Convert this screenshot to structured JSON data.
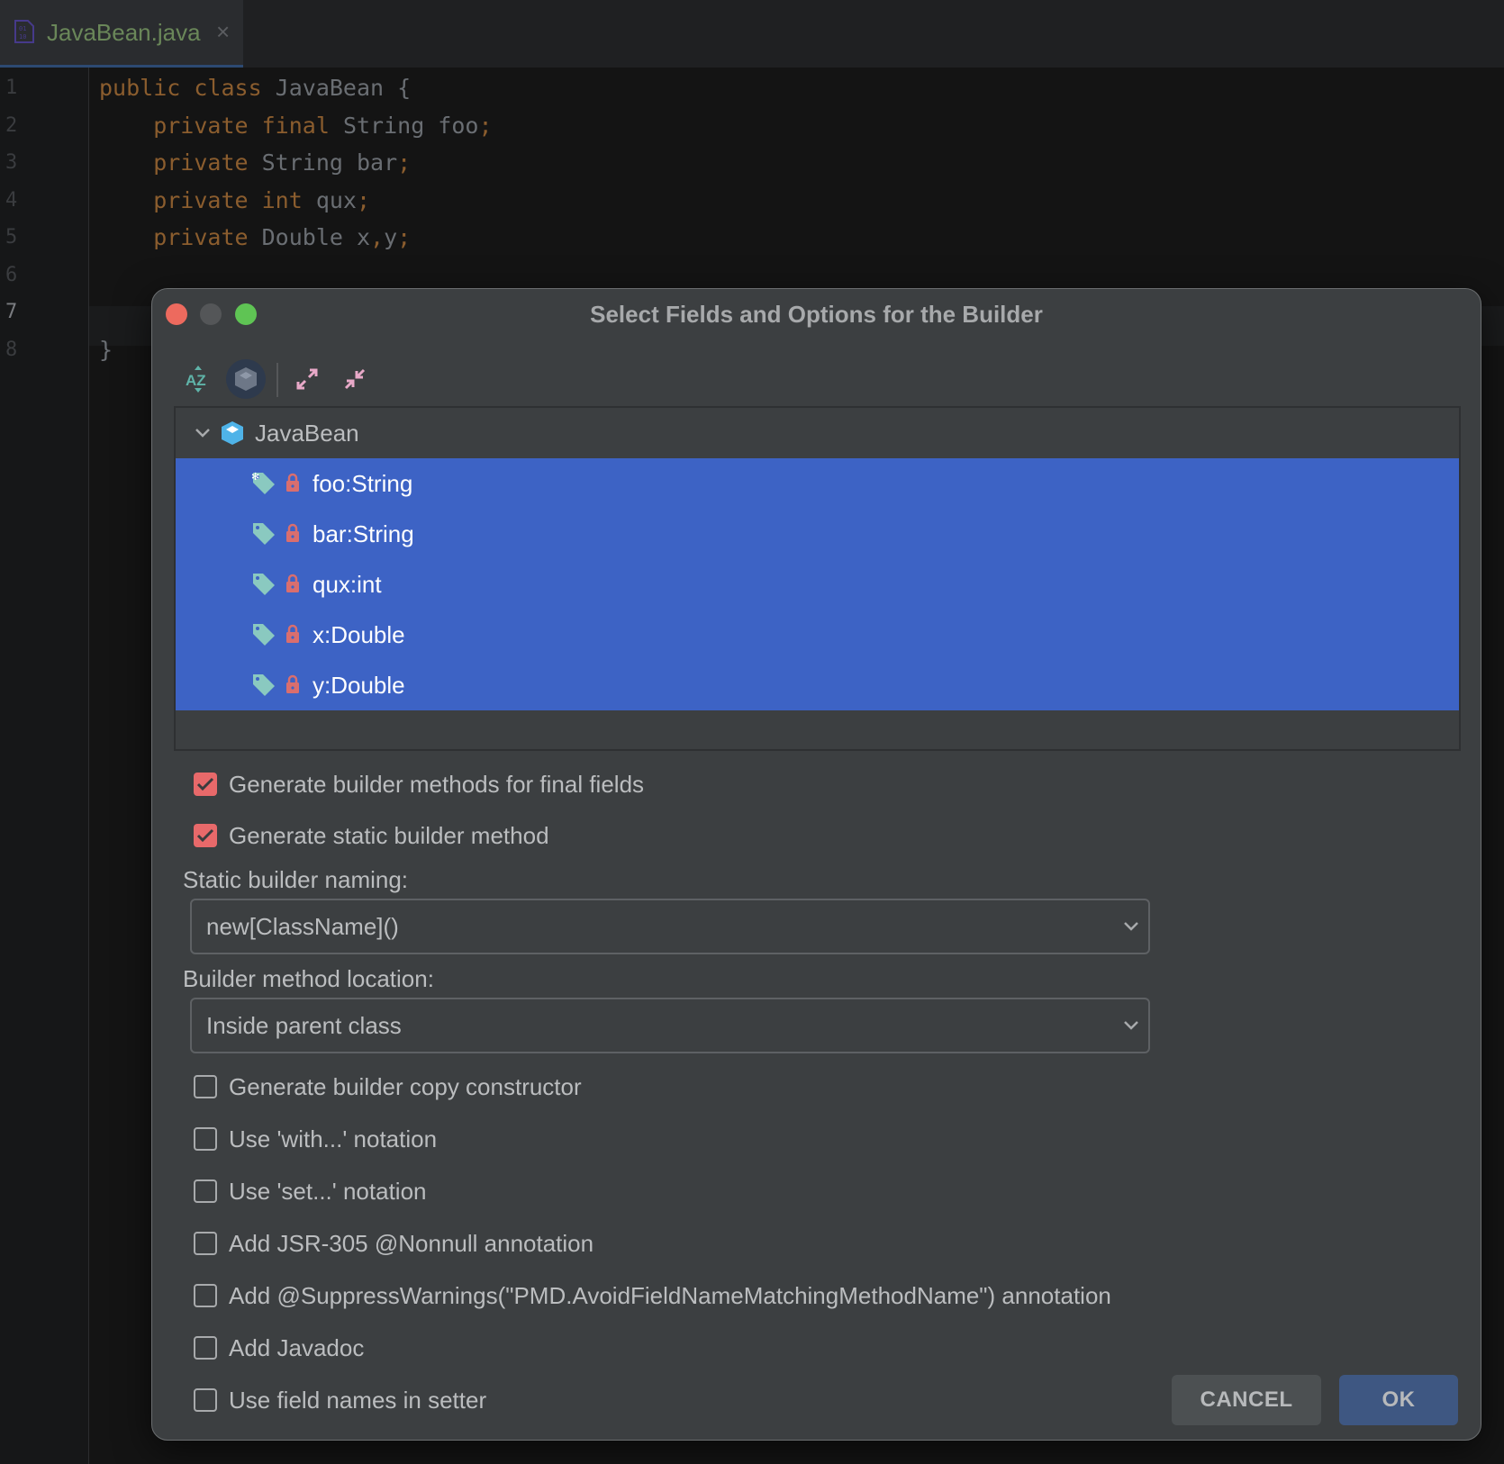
{
  "editor": {
    "tab": {
      "label": "JavaBean.java",
      "icon": "binary-file-icon",
      "close_icon": "close-icon",
      "close_glyph": "×"
    },
    "line_numbers": [
      "1",
      "2",
      "3",
      "4",
      "5",
      "6",
      "7",
      "8"
    ],
    "current_line": "7",
    "code": [
      [
        {
          "t": "public class ",
          "c": "kw"
        },
        {
          "t": "JavaBean ",
          "c": "id"
        },
        {
          "t": "{",
          "c": "id"
        }
      ],
      [
        {
          "t": "    private final ",
          "c": "kw"
        },
        {
          "t": "String foo",
          "c": "id"
        },
        {
          "t": ";",
          "c": "punc"
        }
      ],
      [
        {
          "t": "    private ",
          "c": "kw"
        },
        {
          "t": "String bar",
          "c": "id"
        },
        {
          "t": ";",
          "c": "punc"
        }
      ],
      [
        {
          "t": "    private int ",
          "c": "kw"
        },
        {
          "t": "qux",
          "c": "id"
        },
        {
          "t": ";",
          "c": "punc"
        }
      ],
      [
        {
          "t": "    private ",
          "c": "kw"
        },
        {
          "t": "Double x",
          "c": "id"
        },
        {
          "t": ",",
          "c": "punc"
        },
        {
          "t": "y",
          "c": "id"
        },
        {
          "t": ";",
          "c": "punc"
        }
      ],
      [],
      [],
      [
        {
          "t": "}",
          "c": "id"
        }
      ]
    ]
  },
  "dialog": {
    "title": "Select Fields and Options for the Builder",
    "toolbar": {
      "sort_alpha": "sort-alphabetically-icon",
      "show_classes": "show-classes-icon",
      "expand_all": "expand-all-icon",
      "collapse_all": "collapse-all-icon"
    },
    "tree": {
      "root": {
        "label": "JavaBean",
        "icon": "class-icon",
        "expanded": true
      },
      "fields": [
        {
          "label": "foo:String",
          "final": true,
          "selected": true
        },
        {
          "label": "bar:String",
          "final": false,
          "selected": true
        },
        {
          "label": "qux:int",
          "final": false,
          "selected": true
        },
        {
          "label": "x:Double",
          "final": false,
          "selected": true
        },
        {
          "label": "y:Double",
          "final": false,
          "selected": true
        }
      ]
    },
    "options_top": [
      {
        "label": "Generate builder methods for final fields",
        "checked": true
      },
      {
        "label": "Generate static builder method",
        "checked": true
      }
    ],
    "static_builder_naming": {
      "label": "Static builder naming:",
      "value": "new[ClassName]()"
    },
    "builder_method_location": {
      "label": "Builder method location:",
      "value": "Inside parent class"
    },
    "options_bottom": [
      {
        "label": "Generate builder copy constructor",
        "checked": false
      },
      {
        "label": "Use 'with...' notation",
        "checked": false
      },
      {
        "label": "Use 'set...' notation",
        "checked": false
      },
      {
        "label": "Add JSR-305 @Nonnull annotation",
        "checked": false
      },
      {
        "label": "Add @SuppressWarnings(\"PMD.AvoidFieldNameMatchingMethodName\") annotation",
        "checked": false
      },
      {
        "label": "Add Javadoc",
        "checked": false
      },
      {
        "label": "Use field names in setter",
        "checked": false
      }
    ],
    "buttons": {
      "cancel": "CANCEL",
      "ok": "OK"
    }
  },
  "colors": {
    "selection": "#3d63c5",
    "checkbox_checked": "#e8696a",
    "ok_button": "#3e5782",
    "tag_icon": "#8ac9c0",
    "lock_icon": "#d96e6e",
    "class_icon": "#4fb3e8"
  }
}
